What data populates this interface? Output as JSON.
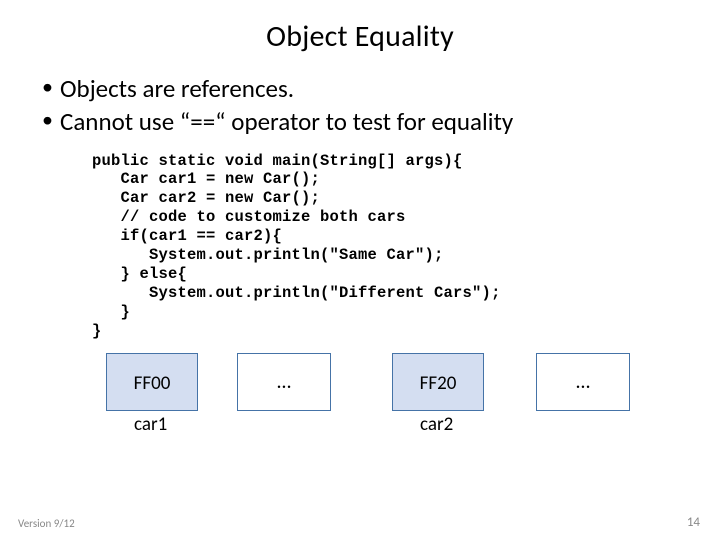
{
  "title": "Object Equality",
  "bullets": {
    "b1": "Objects are references.",
    "b2": "Cannot use “==“ operator to test for equality"
  },
  "code": "public static void main(String[] args){\n   Car car1 = new Car();\n   Car car2 = new Car();\n   // code to customize both cars\n   if(car1 == car2){\n      System.out.println(\"Same Car\");\n   } else{\n      System.out.println(\"Different Cars\");\n   }\n}",
  "diagram": {
    "box1": "FF00",
    "ell1": "…",
    "box3": "FF20",
    "ell2": "…",
    "label1": "car1",
    "label2": "car2"
  },
  "footer": {
    "version": "Version 9/12",
    "page": "14"
  }
}
